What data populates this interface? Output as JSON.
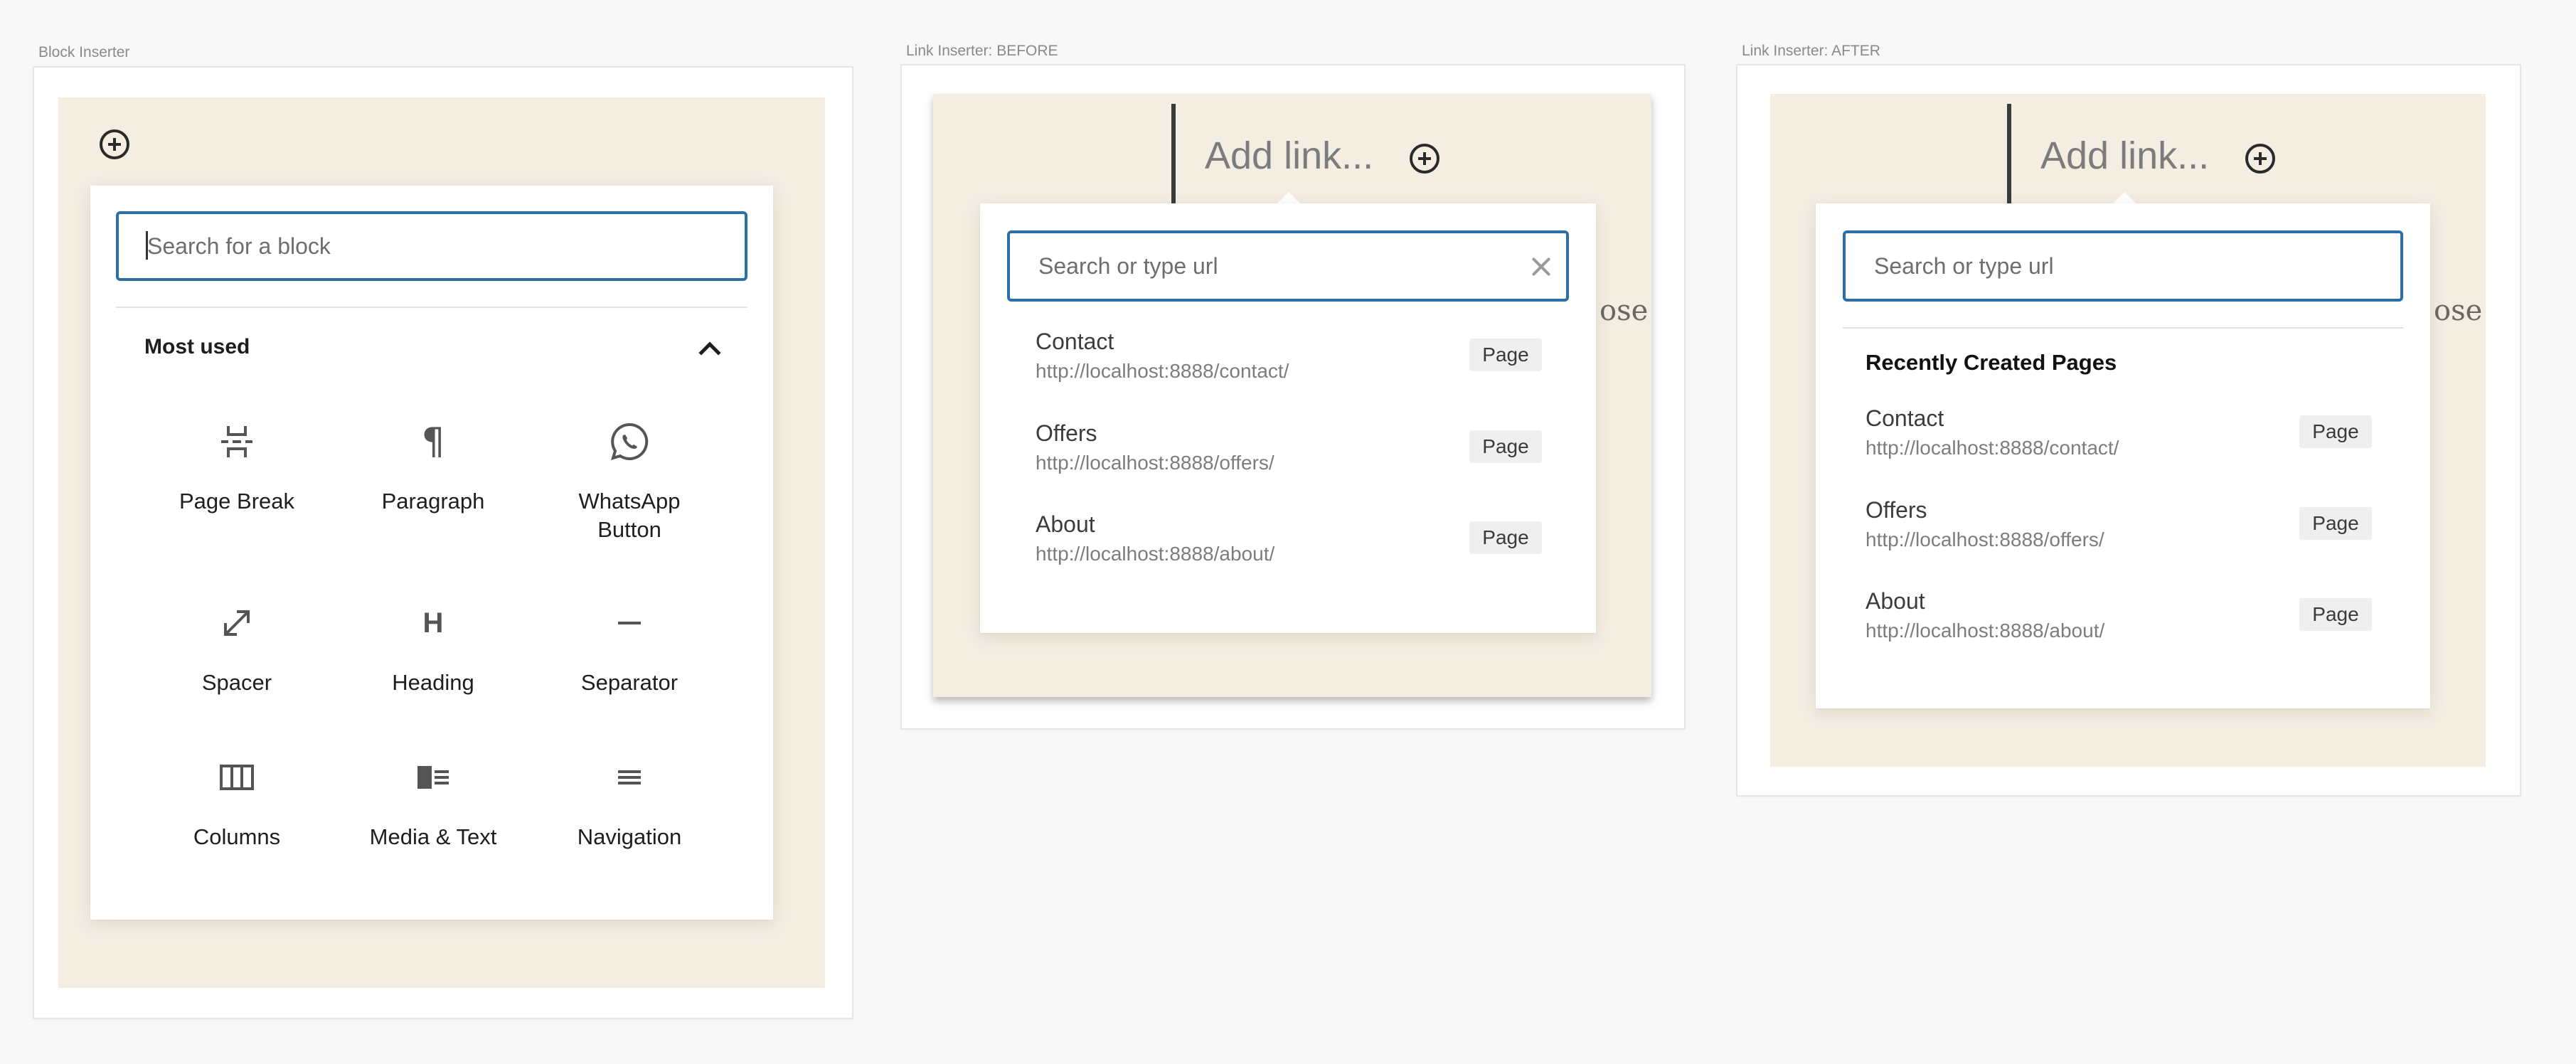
{
  "block_inserter": {
    "frame_label": "Block Inserter",
    "search_placeholder": "Search for a block",
    "section_title": "Most used",
    "blocks": [
      {
        "label": "Page Break",
        "icon": "page-break-icon"
      },
      {
        "label": "Paragraph",
        "icon": "paragraph-icon"
      },
      {
        "label": "WhatsApp\nButton",
        "icon": "whatsapp-icon"
      },
      {
        "label": "Spacer",
        "icon": "spacer-icon"
      },
      {
        "label": "Heading",
        "icon": "heading-icon"
      },
      {
        "label": "Separator",
        "icon": "separator-icon"
      },
      {
        "label": "Columns",
        "icon": "columns-icon"
      },
      {
        "label": "Media & Text",
        "icon": "media-text-icon"
      },
      {
        "label": "Navigation",
        "icon": "navigation-icon"
      }
    ]
  },
  "link_before": {
    "frame_label": "Link Inserter: BEFORE",
    "add_link_text": "Add link...",
    "background_text": "ose",
    "search_placeholder": "Search or type url",
    "results": [
      {
        "title": "Contact",
        "url": "http://localhost:8888/contact/",
        "type": "Page"
      },
      {
        "title": "Offers",
        "url": "http://localhost:8888/offers/",
        "type": "Page"
      },
      {
        "title": "About",
        "url": "http://localhost:8888/about/",
        "type": "Page"
      }
    ]
  },
  "link_after": {
    "frame_label": "Link Inserter: AFTER",
    "add_link_text": "Add link...",
    "background_text": "ose",
    "search_placeholder": "Search or type url",
    "section_title": "Recently Created Pages",
    "results": [
      {
        "title": "Contact",
        "url": "http://localhost:8888/contact/",
        "type": "Page"
      },
      {
        "title": "Offers",
        "url": "http://localhost:8888/offers/",
        "type": "Page"
      },
      {
        "title": "About",
        "url": "http://localhost:8888/about/",
        "type": "Page"
      }
    ]
  },
  "colors": {
    "accent": "#2c6fa6",
    "beige_background": "#f3ede2",
    "page_background": "#f8f8f8"
  }
}
